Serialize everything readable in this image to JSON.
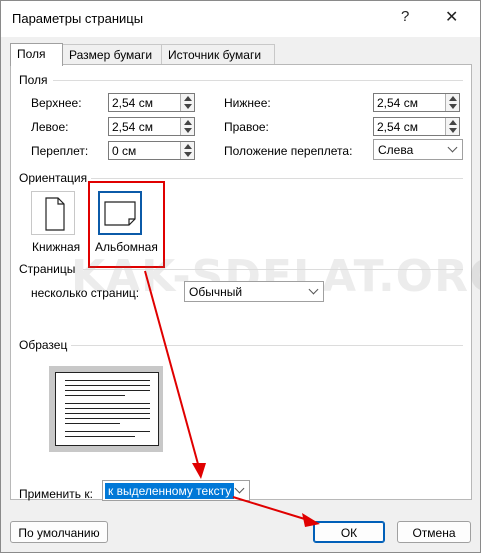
{
  "dialog": {
    "title": "Параметры страницы",
    "help_glyph": "?",
    "close_glyph": "✕"
  },
  "tabs": [
    {
      "label": "Поля",
      "active": true
    },
    {
      "label": "Размер бумаги",
      "active": false
    },
    {
      "label": "Источник бумаги",
      "active": false
    }
  ],
  "margins": {
    "section_label": "Поля",
    "top": {
      "label": "Верхнее:",
      "value": "2,54 см"
    },
    "bottom": {
      "label": "Нижнее:",
      "value": "2,54 см"
    },
    "left": {
      "label": "Левое:",
      "value": "2,54 см"
    },
    "right": {
      "label": "Правое:",
      "value": "2,54 см"
    },
    "gutter": {
      "label": "Переплет:",
      "value": "0 см"
    },
    "gutter_pos": {
      "label": "Положение переплета:",
      "value": "Слева"
    }
  },
  "orientation": {
    "section_label": "Ориентация",
    "portrait_label": "Книжная",
    "landscape_label": "Альбомная",
    "selected": "landscape"
  },
  "pages": {
    "section_label": "Страницы",
    "multiple_label": "несколько страниц:",
    "multiple_value": "Обычный"
  },
  "preview": {
    "section_label": "Образец"
  },
  "apply": {
    "label": "Применить к:",
    "value": "к выделенному тексту"
  },
  "buttons": {
    "default": "По умолчанию",
    "ok": "ОК",
    "cancel": "Отмена"
  },
  "watermark": "KAK-SDELAT.ORG",
  "colors": {
    "highlight": "#e00000",
    "accent": "#005fb8",
    "selection": "#0078d7"
  }
}
